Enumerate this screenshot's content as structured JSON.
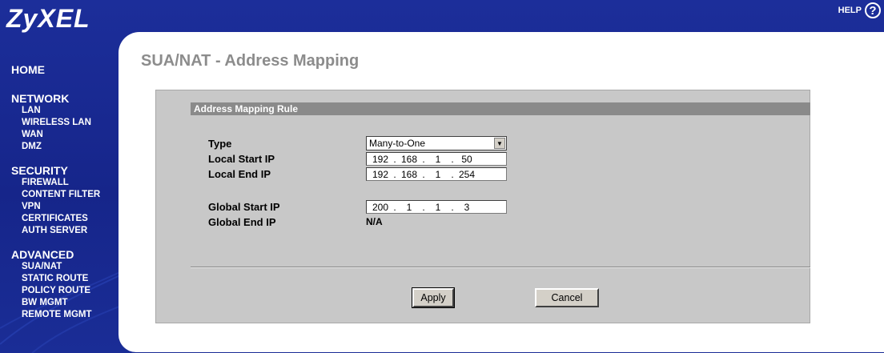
{
  "header": {
    "logo": "ZyXEL",
    "help_label": "HELP",
    "help_glyph": "?"
  },
  "nav": {
    "groups": [
      {
        "label": "HOME",
        "items": []
      },
      {
        "label": "NETWORK",
        "items": [
          "LAN",
          "WIRELESS LAN",
          "WAN",
          "DMZ"
        ]
      },
      {
        "label": "SECURITY",
        "items": [
          "FIREWALL",
          "CONTENT FILTER",
          "VPN",
          "CERTIFICATES",
          "AUTH SERVER"
        ]
      },
      {
        "label": "ADVANCED",
        "items": [
          "SUA/NAT",
          "STATIC ROUTE",
          "POLICY ROUTE",
          "BW MGMT",
          "REMOTE MGMT"
        ]
      }
    ]
  },
  "page": {
    "title": "SUA/NAT - Address Mapping"
  },
  "form": {
    "section_title": "Address Mapping Rule",
    "type_label": "Type",
    "type_value": "Many-to-One",
    "local_start_label": "Local Start IP",
    "local_start_ip": [
      "192",
      "168",
      "1",
      "50"
    ],
    "local_end_label": "Local End IP",
    "local_end_ip": [
      "192",
      "168",
      "1",
      "254"
    ],
    "global_start_label": "Global Start IP",
    "global_start_ip": [
      "200",
      "1",
      "1",
      "3"
    ],
    "global_end_label": "Global End IP",
    "global_end_value": "N/A",
    "ip_separator": ".",
    "apply_label": "Apply",
    "cancel_label": "Cancel"
  },
  "colors": {
    "sidebar": "#1a2a8c",
    "page_title": "#8c8c8c",
    "panel": "#c8c8c8",
    "section_bar": "#8a8a8a"
  }
}
